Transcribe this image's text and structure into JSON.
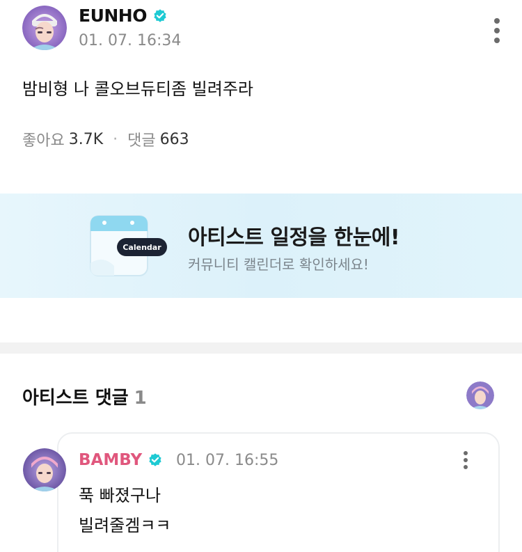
{
  "post": {
    "author": "EUNHO",
    "time": "01. 07. 16:34",
    "body": "밤비형 나 콜오브듀티좀 빌려주라",
    "likes_label": "좋아요",
    "likes_value": "3.7K",
    "separator": "·",
    "comments_label": "댓글",
    "comments_value": "663"
  },
  "banner": {
    "calendar_label": "Calendar",
    "title": "아티스트 일정을 한눈에!",
    "subtitle": "커뮤니티 캘린더로 확인하세요!"
  },
  "artist_comments": {
    "title": "아티스트 댓글",
    "count": "1"
  },
  "comment": {
    "author": "BAMBY",
    "time": "01. 07. 16:55",
    "lines": [
      "푹 빠졌구나",
      "빌려줄겜ㅋㅋ"
    ]
  },
  "colors": {
    "verified_badge": "#1ecad3",
    "comment_author": "#e0577d",
    "banner_bg": "#dcf1fa",
    "calendar_header": "#8fd8f0",
    "calendar_label_bg": "#1c2333"
  },
  "icons": {
    "verified": "verified-badge-icon",
    "more": "more-vertical-icon",
    "calendar": "calendar-icon"
  }
}
